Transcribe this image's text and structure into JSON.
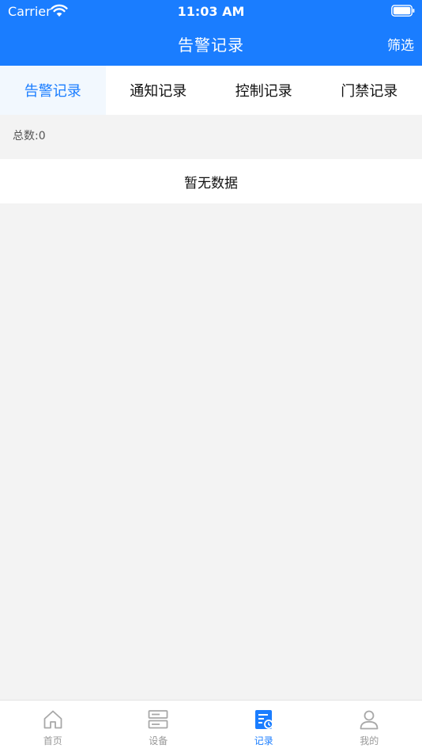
{
  "status_bar": {
    "carrier": "Carrier",
    "time": "11:03 AM"
  },
  "nav": {
    "title": "告警记录",
    "filter_label": "筛选"
  },
  "tabs": [
    {
      "label": "告警记录",
      "active": true
    },
    {
      "label": "通知记录",
      "active": false
    },
    {
      "label": "控制记录",
      "active": false
    },
    {
      "label": "门禁记录",
      "active": false
    }
  ],
  "summary": {
    "total_label": "总数:0"
  },
  "empty_state": {
    "message": "暂无数据"
  },
  "tabbar": [
    {
      "label": "首页",
      "icon": "home-icon",
      "active": false
    },
    {
      "label": "设备",
      "icon": "device-icon",
      "active": false
    },
    {
      "label": "记录",
      "icon": "record-icon",
      "active": true
    },
    {
      "label": "我的",
      "icon": "user-icon",
      "active": false
    }
  ],
  "colors": {
    "primary": "#1a7dff",
    "background": "#f3f3f3",
    "active_tab_bg": "#f2f8fe",
    "inactive_icon": "#a8a8a8"
  }
}
